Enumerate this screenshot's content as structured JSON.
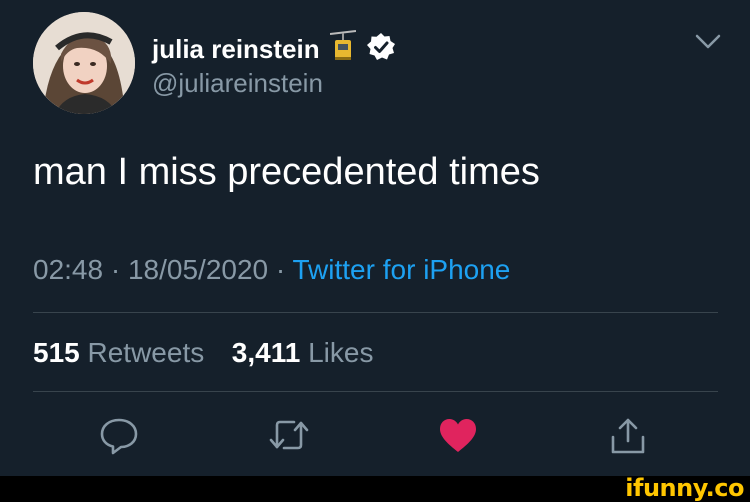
{
  "tweet": {
    "author_name": "julia reinstein",
    "author_handle": "@juliareinstein",
    "text": "man I miss precedented times",
    "time": "02:48",
    "date": "18/05/2020",
    "source": "Twitter for iPhone",
    "retweets_count": "515",
    "retweets_label": "Retweets",
    "likes_count": "3,411",
    "likes_label": "Likes",
    "liked": true
  },
  "icons": {
    "name_emoji": "aerial-tramway-icon",
    "verified": "verified-badge-icon",
    "menu": "chevron-down-icon",
    "reply": "reply-icon",
    "retweet": "retweet-icon",
    "like": "heart-icon",
    "share": "share-icon"
  },
  "colors": {
    "background": "#15202b",
    "secondary_text": "#8899a6",
    "link": "#1da1f2",
    "like": "#e0245e",
    "divider": "#38444d",
    "watermark": "#ffc600"
  },
  "watermark": "ifunny.co"
}
